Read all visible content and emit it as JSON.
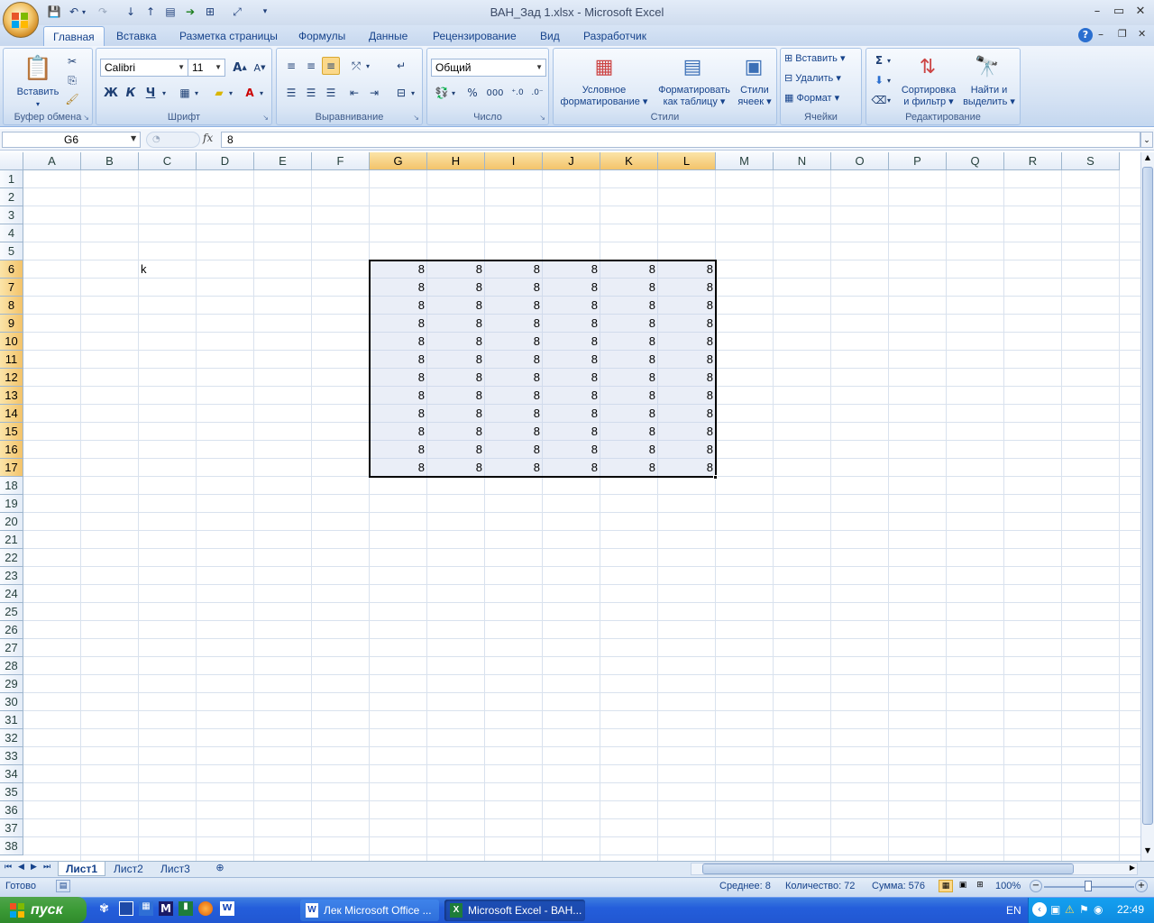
{
  "window": {
    "title": "ВАН_Зад 1.xlsx - Microsoft Excel",
    "minimize": "–",
    "maximize": "▭",
    "close": "✕"
  },
  "tabs": [
    {
      "label": "Главная"
    },
    {
      "label": "Вставка"
    },
    {
      "label": "Разметка страницы"
    },
    {
      "label": "Формулы"
    },
    {
      "label": "Данные"
    },
    {
      "label": "Рецензирование"
    },
    {
      "label": "Вид"
    },
    {
      "label": "Разработчик"
    }
  ],
  "ribbon": {
    "clipboard": {
      "label": "Буфер обмена",
      "paste": "Вставить"
    },
    "font": {
      "label": "Шрифт",
      "family": "Calibri",
      "size": "11",
      "bold": "Ж",
      "italic": "К",
      "underline": "Ч",
      "grow": "A",
      "shrink": "A"
    },
    "alignment": {
      "label": "Выравнивание"
    },
    "number": {
      "label": "Число",
      "format": "Общий",
      "percent": "%",
      "thousands": "000"
    },
    "styles": {
      "label": "Стили",
      "conditional_1": "Условное",
      "conditional_2": "форматирование",
      "table_1": "Форматировать",
      "table_2": "как таблицу",
      "cell_1": "Стили",
      "cell_2": "ячеек"
    },
    "cells": {
      "label": "Ячейки",
      "insert": "Вставить",
      "delete": "Удалить",
      "format": "Формат"
    },
    "editing": {
      "label": "Редактирование",
      "sigma": "Σ",
      "sort_1": "Сортировка",
      "sort_2": "и фильтр",
      "find_1": "Найти и",
      "find_2": "выделить"
    }
  },
  "formula_bar": {
    "name_box": "G6",
    "fx": "fx",
    "value": "8"
  },
  "columns": [
    "A",
    "B",
    "C",
    "D",
    "E",
    "F",
    "G",
    "H",
    "I",
    "J",
    "K",
    "L",
    "M",
    "N",
    "O",
    "P",
    "Q",
    "R",
    "S"
  ],
  "rows": [
    "1",
    "2",
    "3",
    "4",
    "5",
    "6",
    "7",
    "8",
    "9",
    "10",
    "11",
    "12",
    "13",
    "14",
    "15",
    "16",
    "17",
    "18",
    "19",
    "20",
    "21",
    "22",
    "23",
    "24",
    "25",
    "26",
    "27",
    "28",
    "29",
    "30",
    "31",
    "32",
    "33",
    "34",
    "35",
    "36",
    "37",
    "38"
  ],
  "cells": {
    "C6": "k",
    "block_value": "8",
    "block_rows": [
      "6",
      "7",
      "8",
      "9",
      "10",
      "11",
      "12",
      "13",
      "14",
      "15",
      "16",
      "17"
    ],
    "block_cols": [
      "G",
      "H",
      "I",
      "J",
      "K",
      "L"
    ]
  },
  "sheets": [
    {
      "label": "Лист1"
    },
    {
      "label": "Лист2"
    },
    {
      "label": "Лист3"
    }
  ],
  "status": {
    "ready": "Готово",
    "average": "Среднее: 8",
    "count": "Количество: 72",
    "sum": "Сумма: 576",
    "zoom": "100%"
  },
  "taskbar": {
    "start": "пуск",
    "items": [
      {
        "label": "Лек Microsoft Office ..."
      },
      {
        "label": "Microsoft Excel - ВАН..."
      }
    ],
    "lang": "EN",
    "clock": "22:49"
  }
}
